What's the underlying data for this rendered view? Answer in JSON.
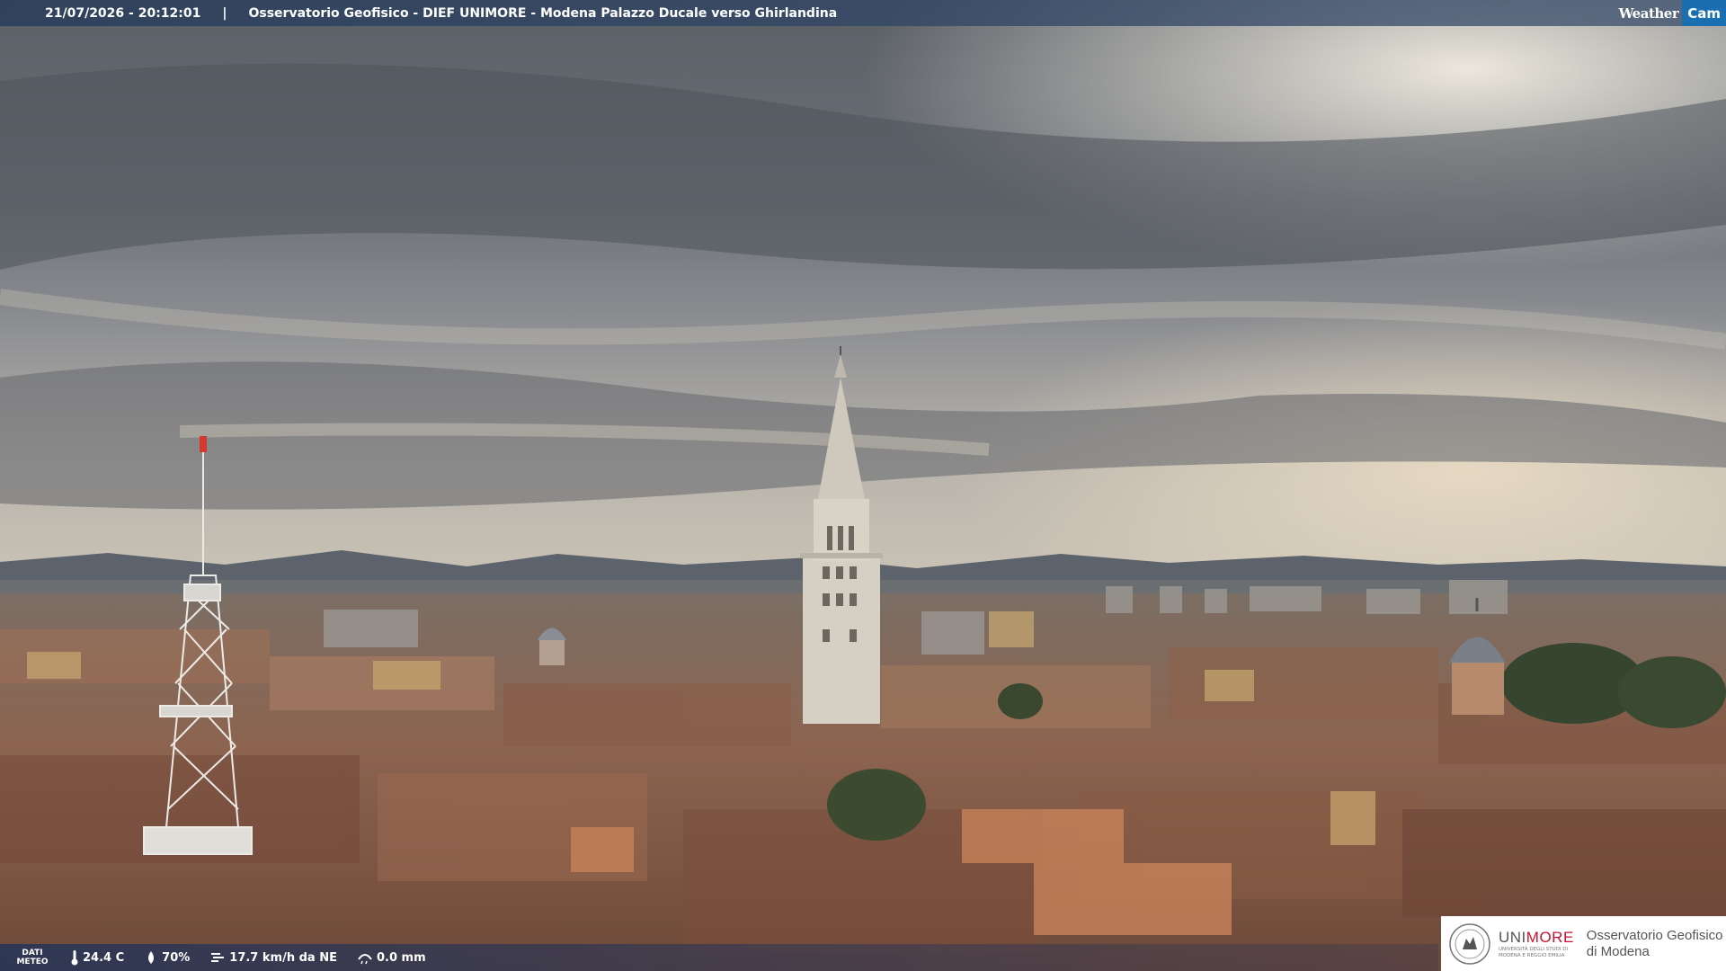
{
  "overlay": {
    "datetime": "21/07/2026 - 20:12:01",
    "separator": "|",
    "title": "Osservatorio Geofisico - DIEF UNIMORE - Modena Palazzo Ducale verso Ghirlandina"
  },
  "brand": {
    "weather_text": "Weather",
    "cam_text": "Cam"
  },
  "weather_data": {
    "label_line1": "DATI",
    "label_line2": "METEO",
    "temperature": "24.4 C",
    "humidity": "70%",
    "wind": "17.7 km/h da NE",
    "rain": "0.0 mm",
    "icons": [
      "thermometer-icon",
      "humidity-drop-icon",
      "wind-icon",
      "rain-gauge-icon"
    ]
  },
  "logo": {
    "uni_part": "UNI",
    "more_part": "MORE",
    "uni_subtitle_1": "UNIVERSITÀ DEGLI STUDI DI",
    "uni_subtitle_2": "MODENA E REGGIO EMILIA",
    "obs_line1": "Osservatorio Geofisico",
    "obs_line2": "di Modena"
  },
  "colors": {
    "sky_top": "#5e636a",
    "sky_light": "#d8d2c4",
    "roof": "#8a5a44",
    "tower": "#d9d2c6",
    "brand_blue": "#1a6fb0",
    "unimore_red": "#c8102e"
  }
}
